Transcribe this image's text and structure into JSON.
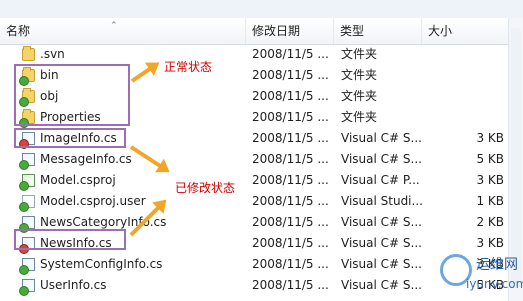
{
  "columns": {
    "name": "名称",
    "date": "修改日期",
    "type": "类型",
    "size": "大小"
  },
  "files": [
    {
      "name": ".svn",
      "date": "2008/11/5 ...",
      "type": "文件夹",
      "size": "",
      "icon": "folder-icon",
      "status": "none"
    },
    {
      "name": "bin",
      "date": "2008/11/5 ...",
      "type": "文件夹",
      "size": "",
      "icon": "folder-icon",
      "status": "normal"
    },
    {
      "name": "obj",
      "date": "2008/11/5 ...",
      "type": "文件夹",
      "size": "",
      "icon": "folder-icon",
      "status": "normal"
    },
    {
      "name": "Properties",
      "date": "2008/11/5 ...",
      "type": "文件夹",
      "size": "",
      "icon": "folder-icon",
      "status": "normal"
    },
    {
      "name": "ImageInfo.cs",
      "date": "2008/11/5 ...",
      "type": "Visual C# S...",
      "size": "3 KB",
      "icon": "csharp-file-icon",
      "status": "modified"
    },
    {
      "name": "MessageInfo.cs",
      "date": "2008/11/5 ...",
      "type": "Visual C# S...",
      "size": "5 KB",
      "icon": "csharp-file-icon",
      "status": "normal"
    },
    {
      "name": "Model.csproj",
      "date": "2008/11/5 ...",
      "type": "Visual C# P...",
      "size": "3 KB",
      "icon": "project-file-icon",
      "status": "normal"
    },
    {
      "name": "Model.csproj.user",
      "date": "2008/11/5 ...",
      "type": "Visual Studi...",
      "size": "1 KB",
      "icon": "project-user-file-icon",
      "status": "normal"
    },
    {
      "name": "NewsCategoryInfo.cs",
      "date": "2008/11/5 ...",
      "type": "Visual C# S...",
      "size": "2 KB",
      "icon": "csharp-file-icon",
      "status": "normal"
    },
    {
      "name": "NewsInfo.cs",
      "date": "2008/11/5 ...",
      "type": "Visual C# S...",
      "size": "3 KB",
      "icon": "csharp-file-icon",
      "status": "modified"
    },
    {
      "name": "SystemConfigInfo.cs",
      "date": "2008/11/5 ...",
      "type": "Visual C# S...",
      "size": "3 KB",
      "icon": "csharp-file-icon",
      "status": "normal"
    },
    {
      "name": "UserInfo.cs",
      "date": "2008/11/5 ...",
      "type": "Visual C# S...",
      "size": "5 KB",
      "icon": "csharp-file-icon",
      "status": "normal"
    }
  ],
  "annotations": {
    "normal": "正常状态",
    "modified": "已修改状态"
  },
  "watermark": {
    "line1": "运维网",
    "line2": "iyunv.com"
  },
  "colors": {
    "annotation_text": "#d10000",
    "annotation_box": "#9e6db3",
    "arrow": "#f2a526",
    "normal_status": "#49a93a",
    "modified_status": "#d64537"
  }
}
